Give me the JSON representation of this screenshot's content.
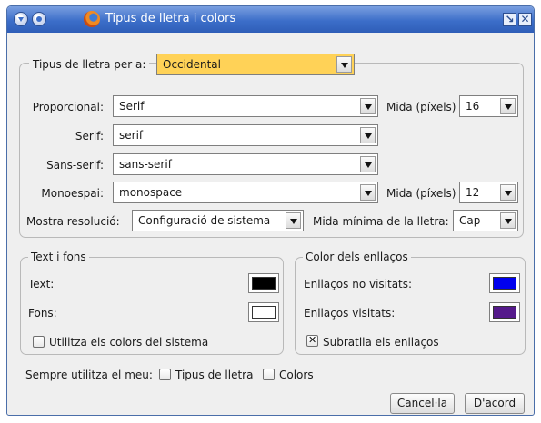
{
  "window": {
    "title": "Tipus de lletra i colors"
  },
  "fonts": {
    "legend_label": "Tipus de lletra per a:",
    "language": "Occidental",
    "proportional_label": "Proporcional:",
    "proportional_value": "Serif",
    "size_label_1": "Mida (píxels)",
    "size_value_1": "16",
    "serif_label": "Serif:",
    "serif_value": "serif",
    "sans_label": "Sans-serif:",
    "sans_value": "sans-serif",
    "mono_label": "Monoespai:",
    "mono_value": "monospace",
    "size_label_2": "Mida (píxels)",
    "size_value_2": "12",
    "resolution_label": "Mostra resolució:",
    "resolution_value": "Configuració de sistema",
    "min_size_label": "Mida mínima de la lletra:",
    "min_size_value": "Cap"
  },
  "text_bg": {
    "legend": "Text i fons",
    "text_label": "Text:",
    "text_color": "#000000",
    "bg_label": "Fons:",
    "bg_color": "#ffffff",
    "system_colors_label": "Utilitza els colors del sistema",
    "system_colors_checked": false
  },
  "links": {
    "legend": "Color dels enllaços",
    "unvisited_label": "Enllaços no visitats:",
    "unvisited_color": "#0000ee",
    "visited_label": "Enllaços visitats:",
    "visited_color": "#551a8b",
    "underline_label": "Subratlla els enllaços",
    "underline_checked": true
  },
  "always_use": {
    "label": "Sempre utilitza el meu:",
    "fonts_label": "Tipus de lletra",
    "colors_label": "Colors"
  },
  "buttons": {
    "cancel": "Cancel·la",
    "ok": "D'acord"
  }
}
